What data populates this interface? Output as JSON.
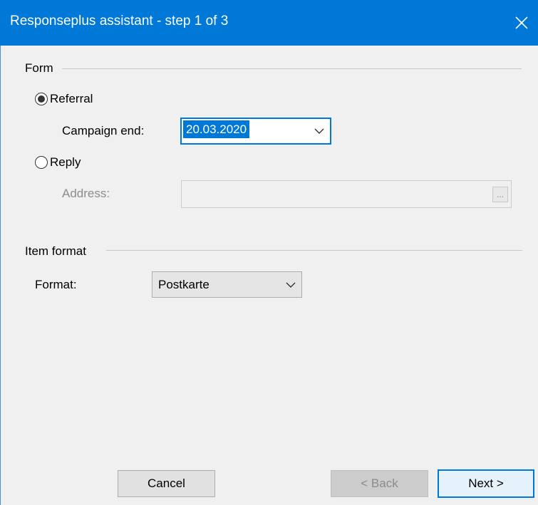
{
  "window": {
    "title": "Responseplus assistant - step 1 of 3",
    "close_icon": "close-icon"
  },
  "form_group": {
    "label": "Form",
    "referral": {
      "label": "Referral",
      "selected": true
    },
    "campaign_end": {
      "label": "Campaign end:",
      "value": "20.03.2020"
    },
    "reply": {
      "label": "Reply",
      "selected": false
    },
    "address": {
      "label": "Address:",
      "value": "",
      "browse_label": "..."
    }
  },
  "item_format_group": {
    "label": "Item format",
    "format": {
      "label": "Format:",
      "value": "Postkarte"
    }
  },
  "buttons": {
    "cancel": "Cancel",
    "back": "< Back",
    "next": "Next >"
  },
  "colors": {
    "titlebar": "#0078d7",
    "accent": "#0078d7"
  }
}
